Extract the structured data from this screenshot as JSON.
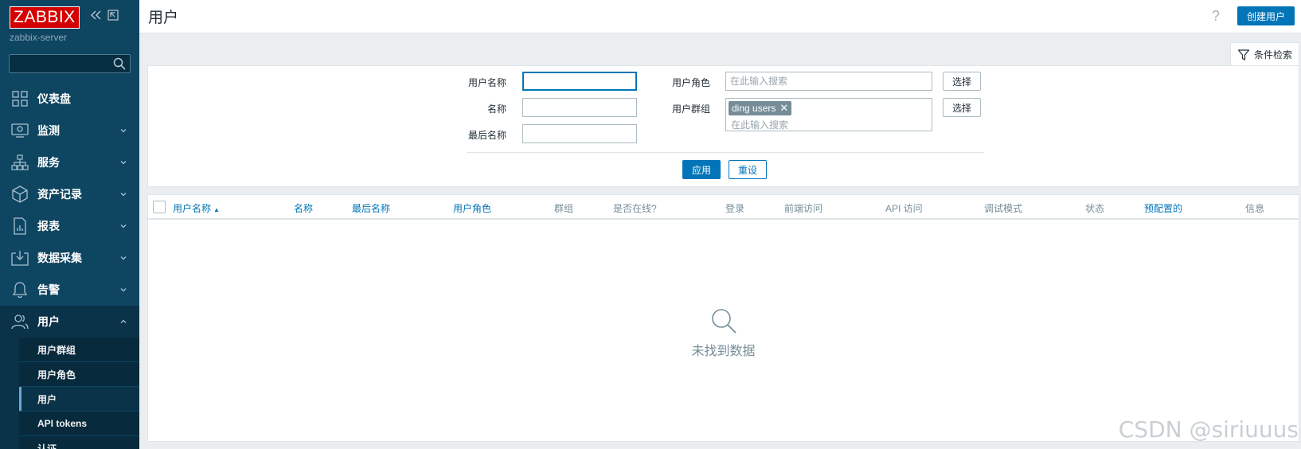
{
  "sidebar": {
    "logo": "ZABBIX",
    "server": "zabbix-server",
    "search_placeholder": "",
    "menu": [
      {
        "label": "仪表盘",
        "icon": "dashboard-icon"
      },
      {
        "label": "监测",
        "icon": "monitoring-icon"
      },
      {
        "label": "服务",
        "icon": "services-icon"
      },
      {
        "label": "资产记录",
        "icon": "inventory-icon"
      },
      {
        "label": "报表",
        "icon": "reports-icon"
      },
      {
        "label": "数据采集",
        "icon": "data-collection-icon"
      },
      {
        "label": "告警",
        "icon": "alerts-icon"
      },
      {
        "label": "用户",
        "icon": "users-icon"
      }
    ],
    "submenu": [
      {
        "label": "用户群组"
      },
      {
        "label": "用户角色"
      },
      {
        "label": "用户"
      },
      {
        "label": "API tokens"
      },
      {
        "label": "认证"
      }
    ]
  },
  "header": {
    "title": "用户",
    "help": "?",
    "create_button": "创建用户"
  },
  "filter": {
    "tab_label": "条件检索",
    "username_label": "用户名称",
    "username_value": "",
    "name_label": "名称",
    "name_value": "",
    "surname_label": "最后名称",
    "surname_value": "",
    "role_label": "用户角色",
    "role_placeholder": "在此输入搜索",
    "group_label": "用户群组",
    "group_chip": "ding users",
    "group_placeholder": "在此输入搜索",
    "select_label": "选择",
    "apply_label": "应用",
    "reset_label": "重设"
  },
  "table": {
    "columns": [
      {
        "label": "用户名称",
        "link": true
      },
      {
        "label": "名称",
        "link": true
      },
      {
        "label": "最后名称",
        "link": true
      },
      {
        "label": "用户角色",
        "link": true
      },
      {
        "label": "群组",
        "link": false
      },
      {
        "label": "是否在线?",
        "link": false
      },
      {
        "label": "登录",
        "link": false
      },
      {
        "label": "前端访问",
        "link": false
      },
      {
        "label": "API 访问",
        "link": false
      },
      {
        "label": "调试模式",
        "link": false
      },
      {
        "label": "状态",
        "link": false
      },
      {
        "label": "预配置的",
        "link": true
      },
      {
        "label": "信息",
        "link": false
      }
    ],
    "sort_indicator": "▲",
    "no_data": "未找到数据"
  },
  "watermark": "CSDN @siriuuus",
  "colors": {
    "sidebar_bg": "#0e4561",
    "accent": "#0275b8",
    "logo_red": "#d40000"
  }
}
